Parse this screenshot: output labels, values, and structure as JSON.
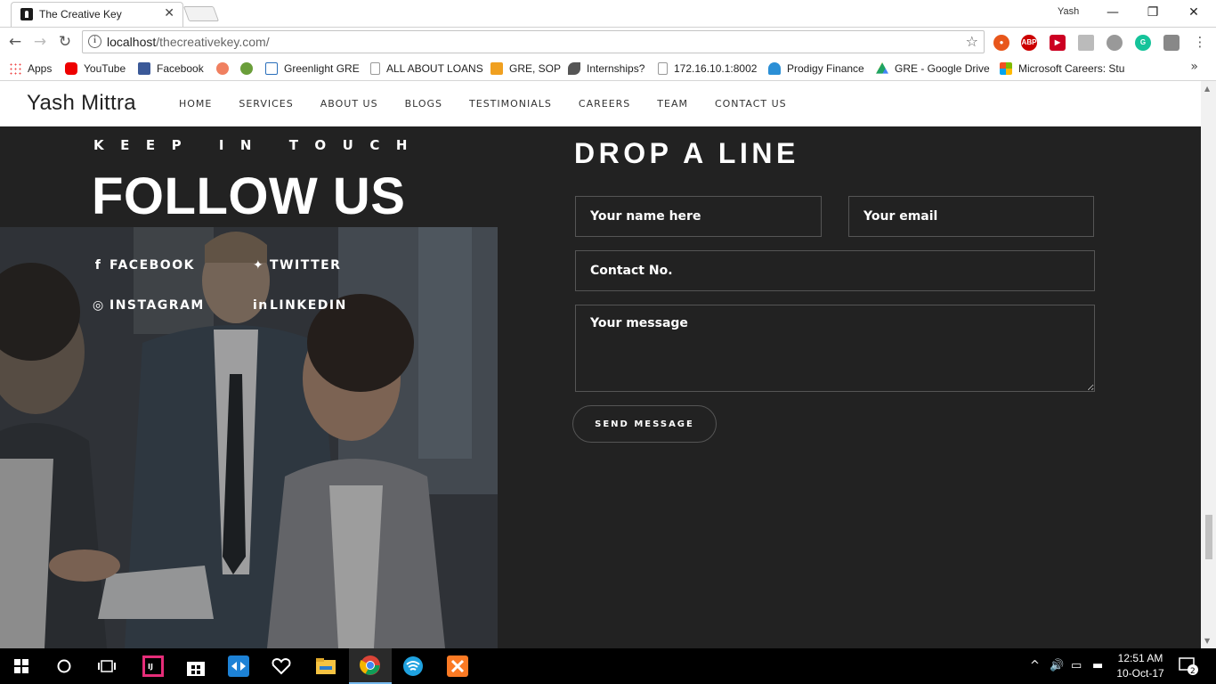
{
  "browser": {
    "tab_title": "The Creative Key",
    "profile_name": "Yash",
    "url_host": "localhost",
    "url_path": "/thecreativekey.com/"
  },
  "bookmarks": [
    {
      "label": "Apps",
      "icon": "apps-grid-icon",
      "color": "#e44"
    },
    {
      "label": "YouTube",
      "icon": "youtube-icon",
      "color": "#e00"
    },
    {
      "label": "Facebook",
      "icon": "facebook-icon",
      "color": "#3b5998"
    },
    {
      "label": "",
      "icon": "owl-icon",
      "color": "#f08060"
    },
    {
      "label": "",
      "icon": "monster-icon",
      "color": "#6a9e3a"
    },
    {
      "label": "Greenlight GRE",
      "icon": "page-icon",
      "color": "#2a6fbb"
    },
    {
      "label": "ALL ABOUT LOANS",
      "icon": "document-icon",
      "color": "#999"
    },
    {
      "label": "GRE, SOP",
      "icon": "chart-icon",
      "color": "#f0a020"
    },
    {
      "label": "Internships?",
      "icon": "leaf-icon",
      "color": "#555"
    },
    {
      "label": "172.16.10.1:8002",
      "icon": "document-icon",
      "color": "#999"
    },
    {
      "label": "Prodigy Finance",
      "icon": "prodigy-icon",
      "color": "#2b8fd6"
    },
    {
      "label": "GRE - Google Drive",
      "icon": "drive-icon",
      "color": "#1fa463"
    },
    {
      "label": "Microsoft Careers: Stu",
      "icon": "microsoft-icon",
      "color": "#f25022"
    }
  ],
  "site": {
    "brand": "Yash Mittra",
    "menu": [
      "HOME",
      "SERVICES",
      "ABOUT US",
      "BLOGS",
      "TESTIMONIALS",
      "CAREERS",
      "TEAM",
      "CONTACT US"
    ]
  },
  "follow": {
    "kicker": "KEEP IN TOUCH",
    "heading": "FOLLOW US",
    "links": [
      {
        "label": "FACEBOOK",
        "icon": "facebook-icon"
      },
      {
        "label": "TWITTER",
        "icon": "twitter-icon"
      },
      {
        "label": "INSTAGRAM",
        "icon": "instagram-icon"
      },
      {
        "label": "LINKEDIN",
        "icon": "linkedin-icon"
      }
    ]
  },
  "contact_form": {
    "title": "DROP A LINE",
    "name_placeholder": "Your name here",
    "email_placeholder": "Your email",
    "phone_placeholder": "Contact No.",
    "message_placeholder": "Your message",
    "submit_label": "SEND MESSAGE"
  },
  "taskbar": {
    "time": "12:51 AM",
    "date": "10-Oct-17",
    "notification_count": "2"
  }
}
